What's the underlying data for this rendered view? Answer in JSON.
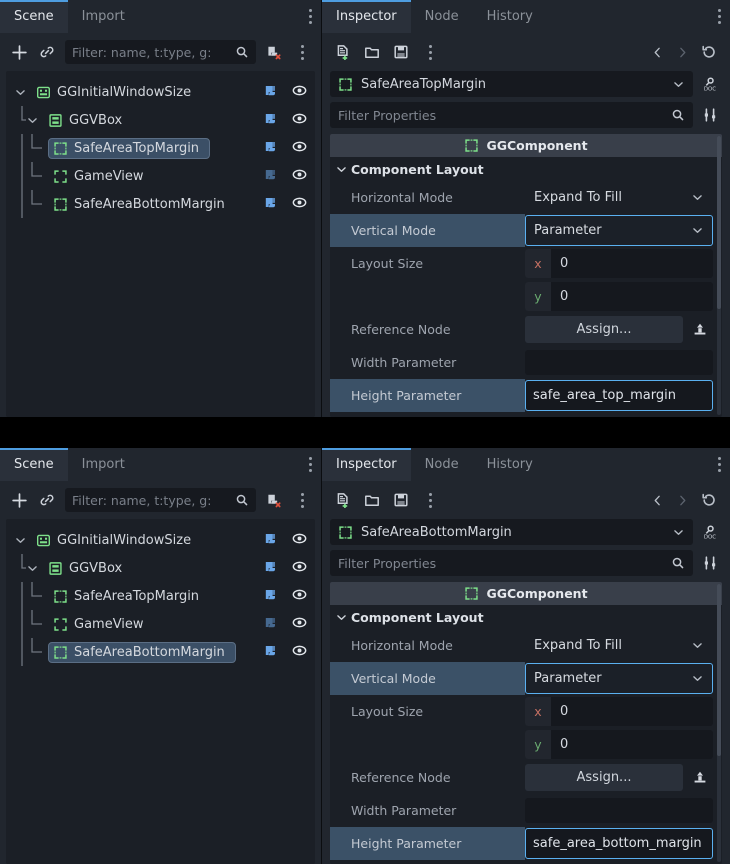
{
  "app": "Godot Editor — Inspector / Scene dock",
  "colors": {
    "panel_bg": "#21262e",
    "tree_bg": "#1b1f26",
    "accent_blue": "#4e9de0",
    "focus_border": "#5ab0f0",
    "row_highlight": "#3b5167",
    "selection": "#3b4f66",
    "node_icon_green": "#7ee08a",
    "script_icon_blue": "#6aa6e8",
    "axis_x": "#c36f62",
    "axis_y": "#6aab70"
  },
  "panels": [
    {
      "id": "top",
      "scene": {
        "tabs": [
          {
            "label": "Scene",
            "active": true
          },
          {
            "label": "Import",
            "active": false
          }
        ],
        "menu_icon": "vertical-dots-icon",
        "toolbar": {
          "add_icon": "plus-icon",
          "link_icon": "instance-child-scene-icon",
          "filter_placeholder": "Filter: name, t:type, g:",
          "search_icon": "search-icon",
          "script_filter_icon": "remove-script-icon",
          "more_icon": "vertical-dots-icon"
        },
        "tree": [
          {
            "label": "GGInitialWindowSize",
            "depth": 0,
            "icon": "control-node-icon",
            "expanded": true,
            "selected": false,
            "script_icon": "script-icon",
            "visibility_icon": "eye-icon",
            "script_dim": false
          },
          {
            "label": "GGVBox",
            "depth": 1,
            "icon": "vbox-container-icon",
            "expanded": true,
            "selected": false,
            "script_icon": "script-icon",
            "visibility_icon": "eye-icon",
            "script_dim": false
          },
          {
            "label": "SafeAreaTopMargin",
            "depth": 2,
            "icon": "component-node-icon",
            "expanded": false,
            "selected": true,
            "script_icon": "script-icon",
            "visibility_icon": "eye-icon",
            "script_dim": false
          },
          {
            "label": "GameView",
            "depth": 2,
            "icon": "control-plain-icon",
            "expanded": false,
            "selected": false,
            "script_icon": "script-icon",
            "visibility_icon": "eye-icon",
            "script_dim": true
          },
          {
            "label": "SafeAreaBottomMargin",
            "depth": 2,
            "icon": "component-node-icon",
            "expanded": false,
            "selected": false,
            "script_icon": "script-icon",
            "visibility_icon": "eye-icon",
            "script_dim": false
          }
        ]
      },
      "inspector": {
        "tabs": [
          {
            "label": "Inspector",
            "active": true
          },
          {
            "label": "Node",
            "active": false
          },
          {
            "label": "History",
            "active": false
          }
        ],
        "menu_icon": "vertical-dots-icon",
        "toolbar": {
          "new_resource_icon": "new-resource-icon",
          "load_icon": "open-folder-icon",
          "save_icon": "save-icon",
          "more_icon": "vertical-dots-icon",
          "back_icon": "chevron-left-icon",
          "forward_icon": "chevron-right-icon",
          "history_icon": "history-icon"
        },
        "object": {
          "icon": "component-node-icon",
          "name": "SafeAreaTopMargin",
          "dropdown_icon": "chevron-down-icon",
          "doc_icon": "open-docs-icon"
        },
        "filter": {
          "placeholder": "Filter Properties",
          "search_icon": "search-icon",
          "tools_icon": "property-tools-icon"
        },
        "component": {
          "icon": "component-node-icon",
          "title": "GGComponent",
          "section": {
            "label": "Component Layout",
            "expanded": true,
            "chevron_icon": "chevron-down-icon"
          }
        },
        "properties": [
          {
            "type": "enum",
            "label": "Horizontal Mode",
            "value": "Expand To Fill",
            "highlight": false,
            "focus": false,
            "chevron_icon": "chevron-down-icon"
          },
          {
            "type": "enum",
            "label": "Vertical Mode",
            "value": "Parameter",
            "highlight": true,
            "focus": true,
            "chevron_icon": "chevron-down-icon"
          },
          {
            "type": "vector2",
            "label": "Layout Size",
            "highlight": false,
            "x_axis": "x",
            "x_value": "0",
            "y_axis": "y",
            "y_value": "0"
          },
          {
            "type": "assign",
            "label": "Reference Node",
            "value": "Assign...",
            "highlight": false,
            "side_icon": "load-node-icon"
          },
          {
            "type": "text",
            "label": "Width Parameter",
            "value": "",
            "highlight": false,
            "focus": false
          },
          {
            "type": "text",
            "label": "Height Parameter",
            "value": "safe_area_top_margin",
            "highlight": true,
            "focus": true
          }
        ]
      }
    },
    {
      "id": "bottom",
      "scene": {
        "tabs": [
          {
            "label": "Scene",
            "active": true
          },
          {
            "label": "Import",
            "active": false
          }
        ],
        "menu_icon": "vertical-dots-icon",
        "toolbar": {
          "add_icon": "plus-icon",
          "link_icon": "instance-child-scene-icon",
          "filter_placeholder": "Filter: name, t:type, g:",
          "search_icon": "search-icon",
          "script_filter_icon": "remove-script-icon",
          "more_icon": "vertical-dots-icon"
        },
        "tree": [
          {
            "label": "GGInitialWindowSize",
            "depth": 0,
            "icon": "control-node-icon",
            "expanded": true,
            "selected": false,
            "script_icon": "script-icon",
            "visibility_icon": "eye-icon",
            "script_dim": false
          },
          {
            "label": "GGVBox",
            "depth": 1,
            "icon": "vbox-container-icon",
            "expanded": true,
            "selected": false,
            "script_icon": "script-icon",
            "visibility_icon": "eye-icon",
            "script_dim": false
          },
          {
            "label": "SafeAreaTopMargin",
            "depth": 2,
            "icon": "component-node-icon",
            "expanded": false,
            "selected": false,
            "script_icon": "script-icon",
            "visibility_icon": "eye-icon",
            "script_dim": false
          },
          {
            "label": "GameView",
            "depth": 2,
            "icon": "control-plain-icon",
            "expanded": false,
            "selected": false,
            "script_icon": "script-icon",
            "visibility_icon": "eye-icon",
            "script_dim": true
          },
          {
            "label": "SafeAreaBottomMargin",
            "depth": 2,
            "icon": "component-node-icon",
            "expanded": false,
            "selected": true,
            "script_icon": "script-icon",
            "visibility_icon": "eye-icon",
            "script_dim": false
          }
        ]
      },
      "inspector": {
        "tabs": [
          {
            "label": "Inspector",
            "active": true
          },
          {
            "label": "Node",
            "active": false
          },
          {
            "label": "History",
            "active": false
          }
        ],
        "menu_icon": "vertical-dots-icon",
        "toolbar": {
          "new_resource_icon": "new-resource-icon",
          "load_icon": "open-folder-icon",
          "save_icon": "save-icon",
          "more_icon": "vertical-dots-icon",
          "back_icon": "chevron-left-icon",
          "forward_icon": "chevron-right-icon",
          "history_icon": "history-icon"
        },
        "object": {
          "icon": "component-node-icon",
          "name": "SafeAreaBottomMargin",
          "dropdown_icon": "chevron-down-icon",
          "doc_icon": "open-docs-icon"
        },
        "filter": {
          "placeholder": "Filter Properties",
          "search_icon": "search-icon",
          "tools_icon": "property-tools-icon"
        },
        "component": {
          "icon": "component-node-icon",
          "title": "GGComponent",
          "section": {
            "label": "Component Layout",
            "expanded": true,
            "chevron_icon": "chevron-down-icon"
          }
        },
        "properties": [
          {
            "type": "enum",
            "label": "Horizontal Mode",
            "value": "Expand To Fill",
            "highlight": false,
            "focus": false,
            "chevron_icon": "chevron-down-icon"
          },
          {
            "type": "enum",
            "label": "Vertical Mode",
            "value": "Parameter",
            "highlight": true,
            "focus": true,
            "chevron_icon": "chevron-down-icon"
          },
          {
            "type": "vector2",
            "label": "Layout Size",
            "highlight": false,
            "x_axis": "x",
            "x_value": "0",
            "y_axis": "y",
            "y_value": "0"
          },
          {
            "type": "assign",
            "label": "Reference Node",
            "value": "Assign...",
            "highlight": false,
            "side_icon": "load-node-icon"
          },
          {
            "type": "text",
            "label": "Width Parameter",
            "value": "",
            "highlight": false,
            "focus": false
          },
          {
            "type": "text",
            "label": "Height Parameter",
            "value": "safe_area_bottom_margin",
            "highlight": true,
            "focus": true
          }
        ]
      }
    }
  ]
}
